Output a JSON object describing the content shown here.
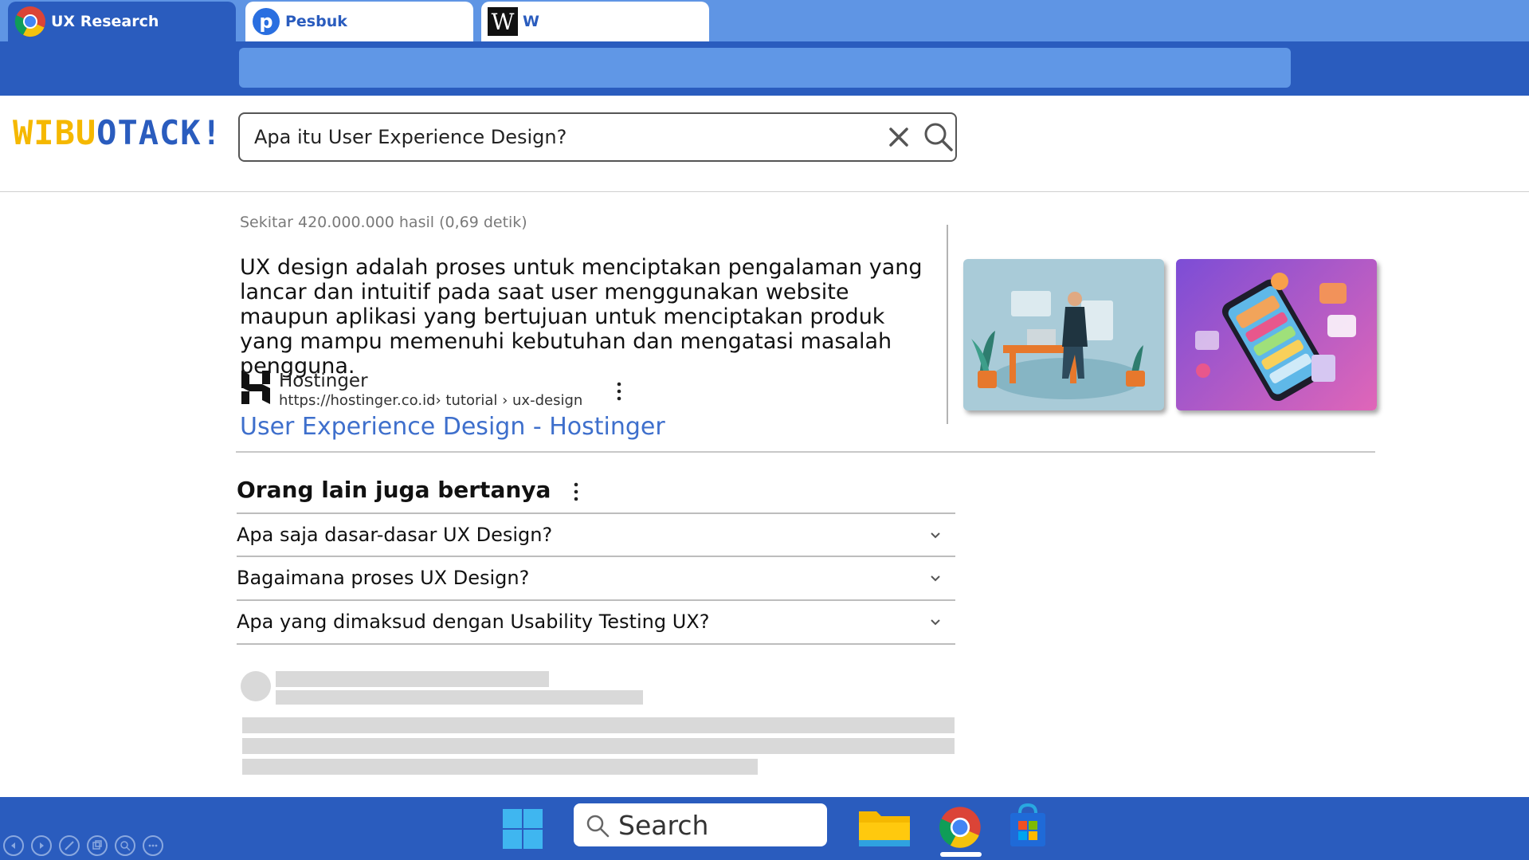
{
  "browser": {
    "tabs": [
      {
        "label": "UX Research",
        "active": true,
        "icon": "chrome-icon"
      },
      {
        "label": "Pesbuk",
        "active": false,
        "icon": "pesbuk-icon"
      },
      {
        "label": "W",
        "active": false,
        "icon": "w-logo-icon"
      }
    ]
  },
  "page": {
    "logo_part1": "WIBU",
    "logo_part2": "OTACK!",
    "search_query": "Apa itu User Experience Design?",
    "stats": "Sekitar 420.000.000 hasil (0,69 detik)",
    "featured_snippet": {
      "text": "UX design adalah proses untuk menciptakan pengalaman yang lancar dan intuitif pada saat user menggunakan website maupun aplikasi yang bertujuan untuk menciptakan produk yang mampu memenuhi kebutuhan dan mengatasi masalah pengguna.",
      "source_name": "Hostinger",
      "source_url": "https://hostinger.co.id› tutorial › ux-design",
      "link_title": "User Experience Design - Hostinger"
    },
    "images": [
      {
        "name": "designer-at-desk-illustration"
      },
      {
        "name": "mobile-app-isometric-illustration"
      }
    ],
    "people_also_ask": {
      "title": "Orang lain juga bertanya",
      "questions": [
        "Apa saja dasar-dasar UX Design?",
        "Bagaimana proses UX Design?",
        "Apa yang dimaksud dengan Usability Testing UX?"
      ]
    }
  },
  "taskbar": {
    "search_label": "Search",
    "icons": [
      "windows-start-icon",
      "file-explorer-icon",
      "chrome-icon",
      "microsoft-store-icon"
    ]
  },
  "colors": {
    "chrome_blue": "#2a5cbe",
    "tab_strip": "#5f95e4",
    "logo_yellow": "#f5b800",
    "link_blue": "#3e6fcc"
  }
}
